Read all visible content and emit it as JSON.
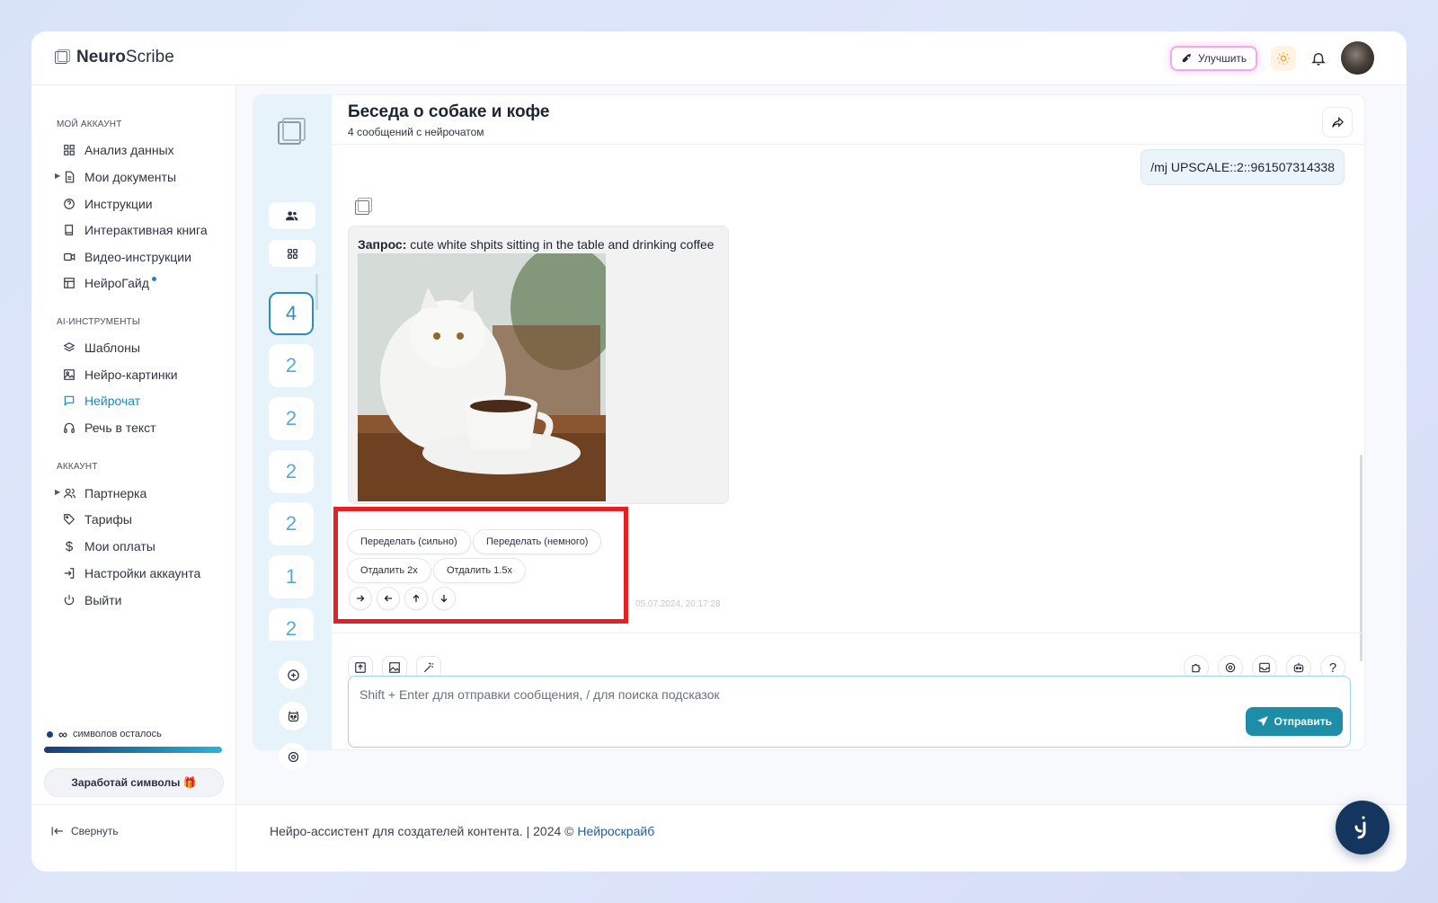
{
  "app": {
    "logo_bold": "Neuro",
    "logo_rest": "Scribe"
  },
  "header": {
    "upgrade_label": "Улучшить"
  },
  "sidebar": {
    "section_account": "МОЙ АККАУНТ",
    "account_items": [
      {
        "label": "Анализ данных"
      },
      {
        "label": "Мои документы"
      },
      {
        "label": "Инструкции"
      },
      {
        "label": "Интерактивная книга"
      },
      {
        "label": "Видео-инструкции"
      },
      {
        "label": "НейроГайд"
      }
    ],
    "section_ai": "AI-ИНСТРУМЕНТЫ",
    "ai_items": [
      {
        "label": "Шаблоны"
      },
      {
        "label": "Нейро-картинки"
      },
      {
        "label": "Нейрочат"
      },
      {
        "label": "Речь в текст"
      }
    ],
    "section_profile": "АККАУНТ",
    "profile_items": [
      {
        "label": "Партнерка"
      },
      {
        "label": "Тарифы"
      },
      {
        "label": "Мои оплаты"
      },
      {
        "label": "Настройки аккаунта"
      },
      {
        "label": "Выйти"
      }
    ],
    "credits_symbol": "∞",
    "credits_label": "символов осталось",
    "credits_progress": 1.0,
    "earn_label": "Заработай символы 🎁",
    "collapse_label": "Свернуть"
  },
  "threads": {
    "counts": [
      "4",
      "2",
      "2",
      "2",
      "2",
      "1",
      "2"
    ]
  },
  "chat": {
    "title": "Беседа о собаке и кофе",
    "subtitle": "4 сообщений с нейрочатом",
    "user_message": "/mj UPSCALE::2::961507314338",
    "bot_prompt_label": "Запрос:",
    "bot_prompt_text": " cute white shpits sitting in the table and drinking coffee",
    "actions": {
      "vary_strong": "Переделать (сильно)",
      "vary_subtle": "Переделать (немного)",
      "zoom_2x": "Отдалить 2x",
      "zoom_15x": "Отдалить 1.5x"
    },
    "timestamp": "05.07.2024, 20:17:28",
    "help_label": "?"
  },
  "composer": {
    "placeholder": "Shift + Enter для отправки сообщения, / для поиска подсказок",
    "send_label": "Отправить"
  },
  "footer": {
    "text": "Нейро-ассистент для создателей контента.  | 2024 © ",
    "link": "Нейроскрайб"
  },
  "colors": {
    "accent": "#1f86b8",
    "send": "#1e8ea8",
    "highlight_box": "#e22127",
    "fab": "#14355e"
  }
}
